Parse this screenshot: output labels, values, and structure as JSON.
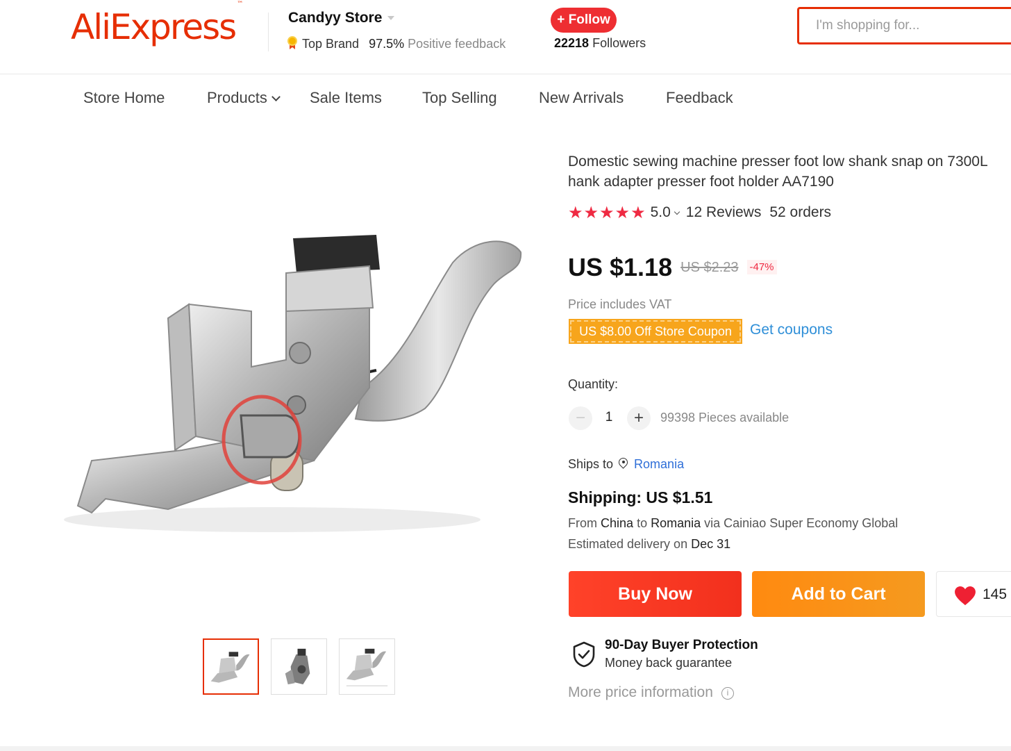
{
  "header": {
    "logo_text": "AliExpress",
    "logo_tm": "™",
    "store_name": "Candyy Store",
    "top_brand": "Top Brand",
    "positive_pct": "97.5%",
    "positive_label": "Positive feedback",
    "follow_label": "+ Follow",
    "followers_count": "22218",
    "followers_label": "Followers",
    "search_placeholder": "I'm shopping for..."
  },
  "nav": {
    "items": [
      {
        "label": "Store Home"
      },
      {
        "label": "Products"
      },
      {
        "label": "Sale Items"
      },
      {
        "label": "Top Selling"
      },
      {
        "label": "New Arrivals"
      },
      {
        "label": "Feedback"
      }
    ]
  },
  "product": {
    "title": "Domestic sewing machine presser foot low shank snap on 7300L\nhank adapter presser foot holder AA7190",
    "stars": "★★★★★",
    "rating": "5.0",
    "reviews": "12 Reviews",
    "orders": "52 orders",
    "price": "US $1.18",
    "old_price": "US $2.23",
    "discount": "-47%",
    "vat_note": "Price includes VAT",
    "coupon": "US $8.00 Off Store Coupon",
    "get_coupons": "Get coupons",
    "quantity_label": "Quantity:",
    "quantity": "1",
    "qty_minus": "−",
    "qty_plus": "+",
    "pieces_available": "99398 Pieces available",
    "ships_to_label": "Ships to",
    "ships_to_country": "Romania",
    "shipping_title": "Shipping: US $1.51",
    "shipping_route_prefix": "From",
    "shipping_origin": "China",
    "shipping_route_to": "to",
    "shipping_dest": "Romania",
    "shipping_route_via": "via Cainiao Super Economy Global",
    "delivery_prefix": "Estimated delivery on",
    "delivery_date": "Dec 31",
    "buy_now": "Buy Now",
    "add_to_cart": "Add to Cart",
    "wishlist_count": "145",
    "protection_title": "90-Day Buyer Protection",
    "protection_sub": "Money back guarantee",
    "more_price_info": "More price information",
    "info_icon": "i"
  },
  "colors": {
    "brand": "#e62e04",
    "follow": "#ee2e32",
    "buy_now": "#f2301d",
    "add_to_cart": "#f59a1f",
    "coupon": "#f7a51c",
    "link": "#2f8fd8",
    "star": "#ef2a42"
  },
  "icons": [
    "medal-icon",
    "chevron-down-icon",
    "star-icon",
    "location-pin-icon",
    "heart-icon",
    "shield-check-icon",
    "info-icon"
  ]
}
